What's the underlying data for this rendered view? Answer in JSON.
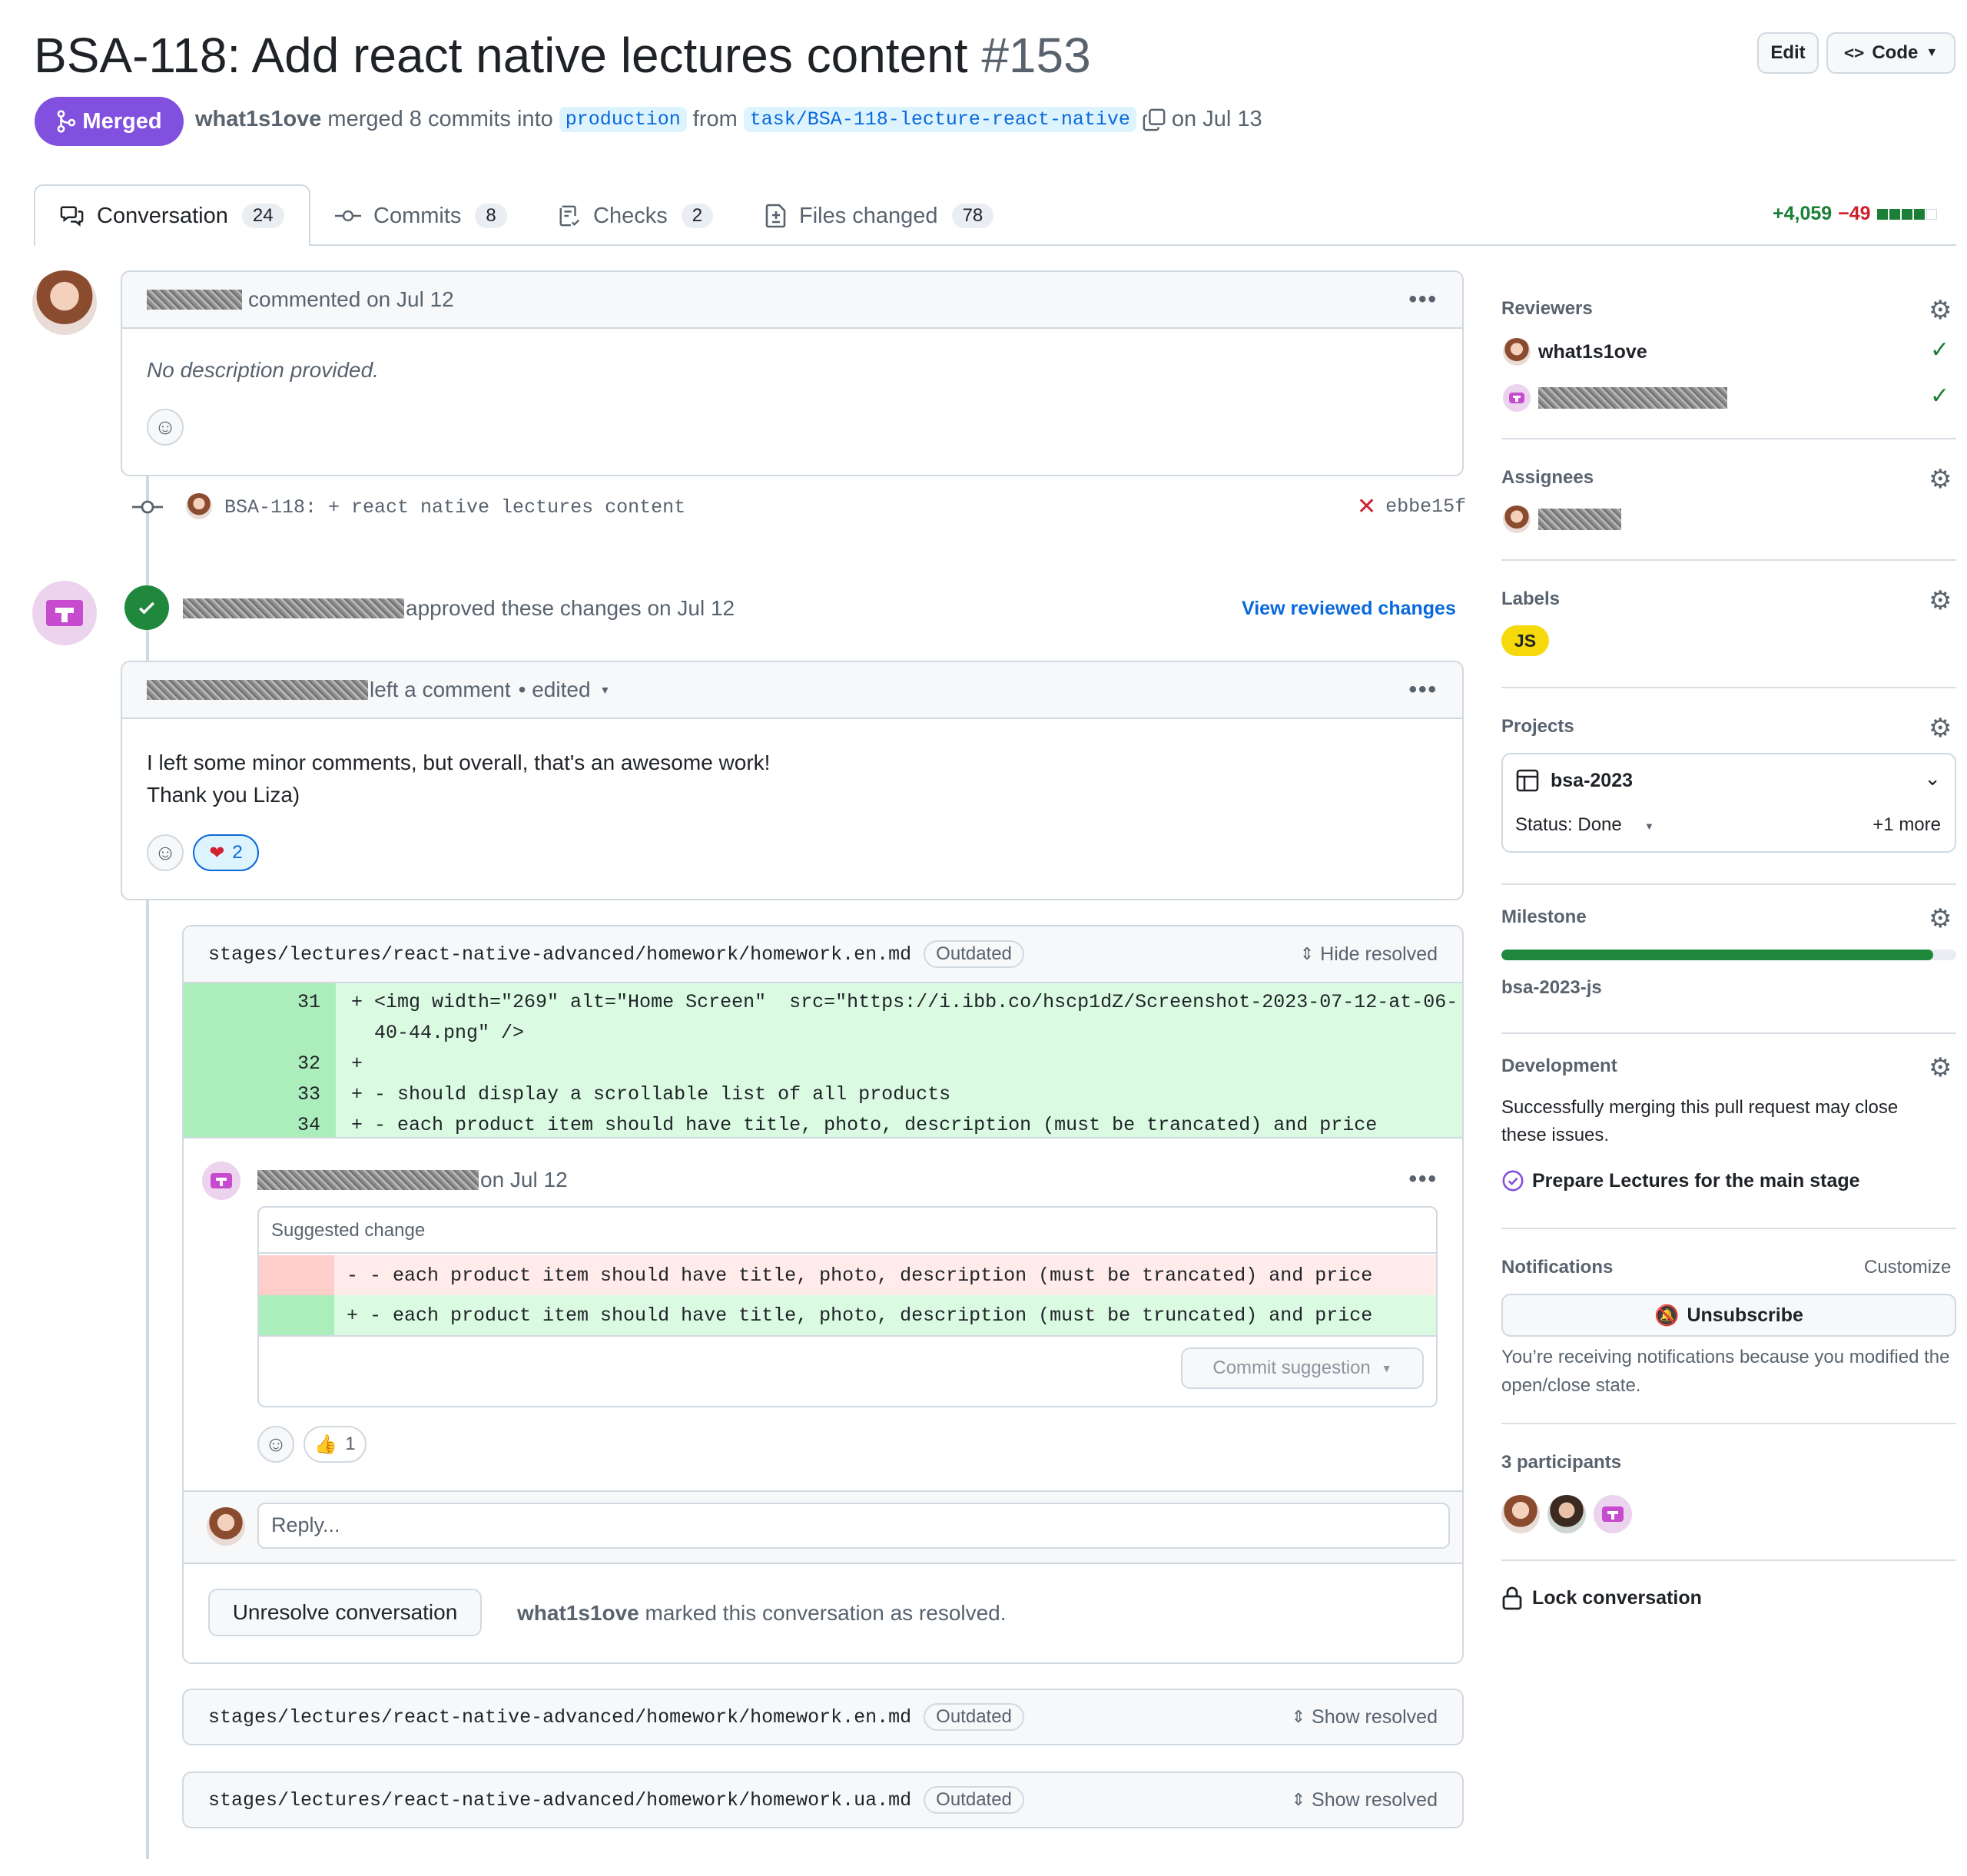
{
  "pr": {
    "title": "BSA-118: Add react native lectures content",
    "number": "#153",
    "state": "Merged",
    "author": "what1s1ove",
    "merged_text": "merged 8 commits into",
    "base_branch": "production",
    "from_text": "from",
    "head_branch": "task/BSA-118-lecture-react-native",
    "date_text": "on Jul 13"
  },
  "header_buttons": {
    "edit": "Edit",
    "code": "Code"
  },
  "tabs": [
    {
      "label": "Conversation",
      "count": "24"
    },
    {
      "label": "Commits",
      "count": "8"
    },
    {
      "label": "Checks",
      "count": "2"
    },
    {
      "label": "Files changed",
      "count": "78"
    }
  ],
  "diffstat": {
    "additions": "+4,059",
    "deletions": "−49"
  },
  "timeline": {
    "comment1": {
      "meta": "commented on Jul 12",
      "body": "No description provided."
    },
    "commit": {
      "message": "BSA-118: + react native lectures content",
      "sha": "ebbe15f"
    },
    "review": {
      "action": "approved these changes on Jul 12",
      "link": "View reviewed changes"
    },
    "comment2": {
      "meta": "left a comment",
      "edited": "• edited",
      "line1": "I left some minor comments, but overall, that's an awesome work!",
      "line2": "Thank you Liza)",
      "heart_count": "2"
    },
    "thread1": {
      "file": "stages/lectures/react-native-advanced/homework/homework.en.md",
      "badge": "Outdated",
      "toggle": "Hide resolved",
      "lines": [
        {
          "num": "31",
          "text": "+ <img width=\"269\" alt=\"Home Screen\"  src=\"https://i.ibb.co/hscp1dZ/Screenshot-2023-07-12-at-06-"
        },
        {
          "num": "",
          "text": "  40-44.png\" />"
        },
        {
          "num": "32",
          "text": "+"
        },
        {
          "num": "33",
          "text": "+ - should display a scrollable list of all products"
        },
        {
          "num": "34",
          "text": "+ - each product item should have title, photo, description (must be trancated) and price"
        }
      ],
      "comment_date": "on Jul 12",
      "suggested_label": "Suggested change",
      "removed_line": "- - each product item should have title, photo, description (must be trancated) and price",
      "added_line": "+ - each product item should have title, photo, description (must be truncated) and price",
      "commit_suggestion": "Commit suggestion",
      "thumbs_count": "1",
      "reply_placeholder": "Reply...",
      "unresolve": "Unresolve conversation",
      "resolved_by": "what1s1ove",
      "resolved_text": "marked this conversation as resolved."
    },
    "thread2": {
      "file": "stages/lectures/react-native-advanced/homework/homework.en.md",
      "badge": "Outdated",
      "toggle": "Show resolved"
    },
    "thread3": {
      "file": "stages/lectures/react-native-advanced/homework/homework.ua.md",
      "badge": "Outdated",
      "toggle": "Show resolved"
    }
  },
  "sidebar": {
    "reviewers": {
      "title": "Reviewers",
      "first": "what1s1ove"
    },
    "assignees": {
      "title": "Assignees"
    },
    "labels": {
      "title": "Labels",
      "items": [
        "JS"
      ],
      "color": "#f5d90a"
    },
    "projects": {
      "title": "Projects",
      "name": "bsa-2023",
      "status": "Status: Done",
      "more": "+1 more"
    },
    "milestone": {
      "title": "Milestone",
      "name": "bsa-2023-js",
      "progress": 0.95
    },
    "development": {
      "title": "Development",
      "text": "Successfully merging this pull request may close these issues.",
      "issue": "Prepare Lectures for the main stage"
    },
    "notifications": {
      "title": "Notifications",
      "customize": "Customize",
      "button": "Unsubscribe",
      "reason": "You’re receiving notifications because you modified the open/close state."
    },
    "participants": {
      "title": "3 participants"
    },
    "lock": "Lock conversation"
  },
  "colors": {
    "merged": "#8250df",
    "link": "#0969da",
    "added_bg": "#dafbe1",
    "removed_bg": "#ffebe9",
    "green": "#1a7f37",
    "red": "#cf222e"
  }
}
